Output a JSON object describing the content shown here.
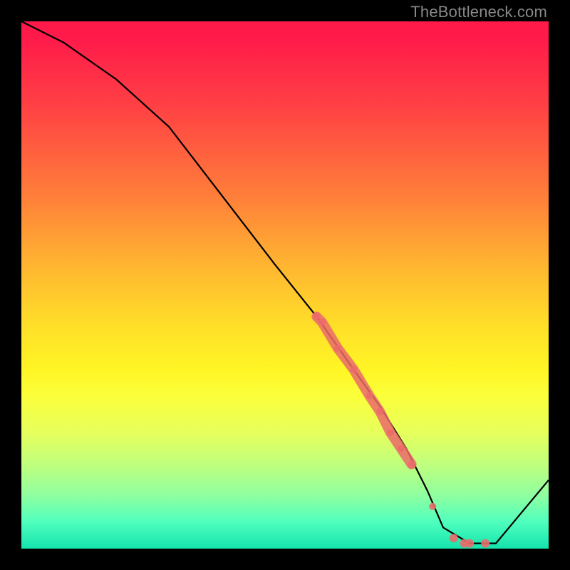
{
  "watermark": "TheBottleneck.com",
  "chart_data": {
    "type": "line",
    "title": "",
    "xlabel": "",
    "ylabel": "",
    "xlim": [
      0,
      100
    ],
    "ylim": [
      0,
      100
    ],
    "series": [
      {
        "name": "curve",
        "x": [
          0,
          8,
          18,
          28,
          38,
          48,
          56,
          63,
          68,
          73,
          77,
          80,
          85,
          90,
          100
        ],
        "y": [
          100,
          96,
          89,
          80,
          67,
          54,
          44,
          34,
          27,
          19,
          11,
          4,
          1,
          1,
          13
        ]
      }
    ],
    "markers": [
      {
        "name": "cluster-start-upper",
        "x": 56,
        "y": 44
      },
      {
        "name": "cluster-start-lower",
        "x": 57,
        "y": 43
      },
      {
        "name": "cluster-band-1",
        "x": 60,
        "y": 38
      },
      {
        "name": "cluster-band-2",
        "x": 63,
        "y": 34
      },
      {
        "name": "cluster-band-3",
        "x": 66,
        "y": 29
      },
      {
        "name": "cluster-band-4",
        "x": 68,
        "y": 26
      },
      {
        "name": "cluster-band-5",
        "x": 70,
        "y": 22
      },
      {
        "name": "cluster-band-6",
        "x": 72,
        "y": 19
      },
      {
        "name": "cluster-band-end",
        "x": 74,
        "y": 16
      },
      {
        "name": "isolated-mid",
        "x": 78,
        "y": 8
      },
      {
        "name": "trough-1",
        "x": 82,
        "y": 2
      },
      {
        "name": "trough-2",
        "x": 84,
        "y": 1
      },
      {
        "name": "trough-3",
        "x": 85,
        "y": 1
      },
      {
        "name": "trough-4",
        "x": 88,
        "y": 1
      }
    ],
    "marker_color": "#ea6a6a",
    "curve_color": "#000000",
    "background_gradient": [
      "#ff1a4a",
      "#ffe028",
      "#14e3ac"
    ]
  }
}
